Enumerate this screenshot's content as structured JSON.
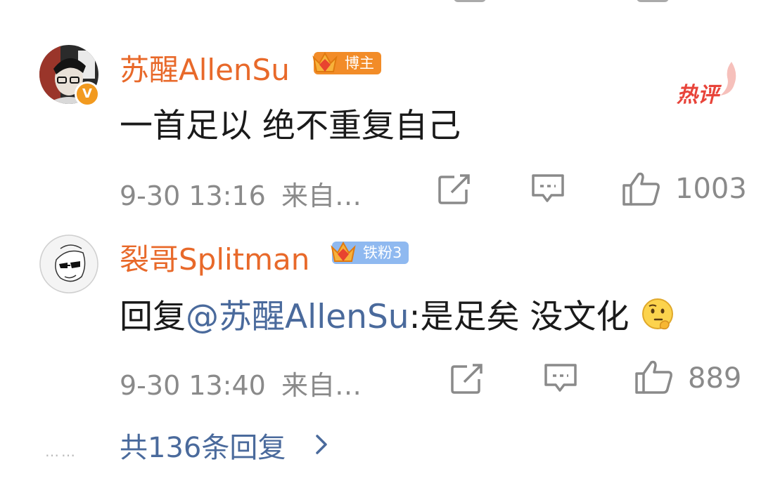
{
  "comments": [
    {
      "username": "苏醒AllenSu",
      "badge": "博主",
      "badge_color": "#f28c28",
      "verified": "V",
      "text": "一首足以 绝不重复自己",
      "time": "9-30 13:16",
      "source": "来自…",
      "likes": "1003",
      "hot_label": "热评"
    },
    {
      "username": "裂哥Splitman",
      "badge": "铁粉3",
      "badge_color": "#8fb9f0",
      "reply_prefix": "回复",
      "mention": "@苏醒AllenSu",
      "text": ":是足矣 没文化",
      "emoji": "thinking-face",
      "time": "9-30 13:40",
      "source": "来自…",
      "likes": "889"
    }
  ],
  "footer": {
    "dots": "……",
    "more_replies": "共136条回复"
  },
  "icons": {
    "share": "share-icon",
    "comment": "comment-icon",
    "like": "thumb-up-icon",
    "more": "chevron-right-icon"
  },
  "colors": {
    "username": "#e8692a",
    "link": "#4a6a9c",
    "meta": "#8a8a8a",
    "hot": "#e8443a"
  }
}
